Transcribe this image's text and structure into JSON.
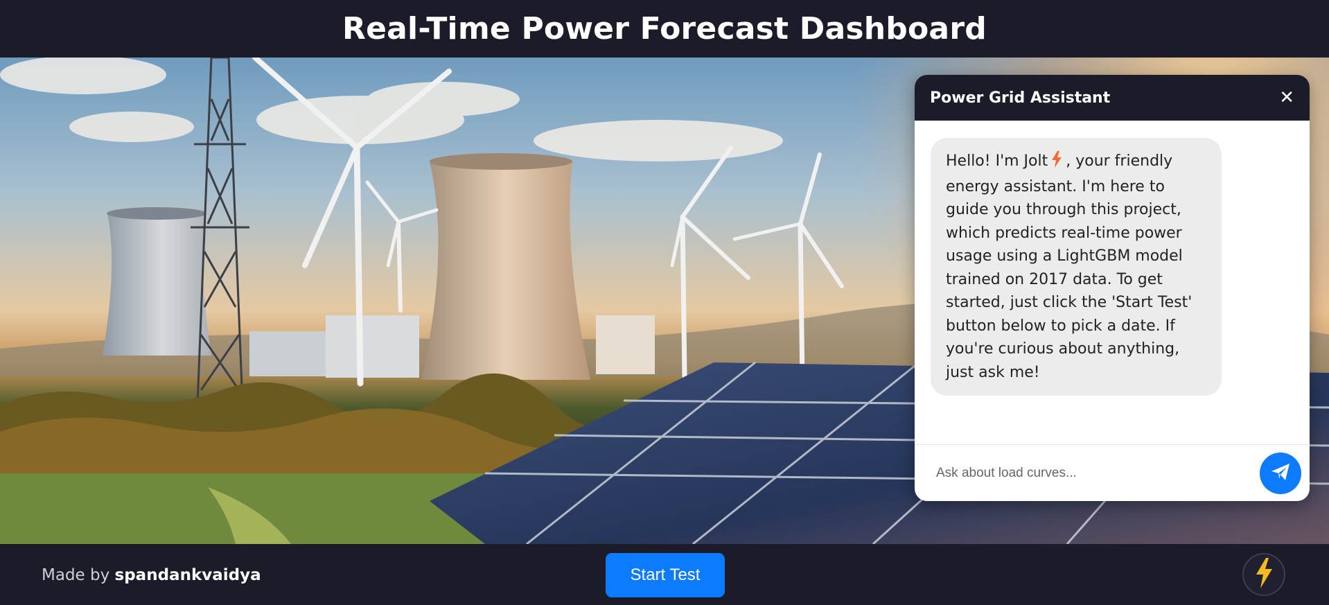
{
  "header": {
    "title": "Real-Time Power Forecast Dashboard"
  },
  "hero": {
    "image": "wind-turbines-cooling-towers-solar-panels-scene"
  },
  "chat": {
    "title": "Power Grid Assistant",
    "close_label": "✕",
    "messages": [
      {
        "sender": "assistant",
        "text_before_icon": "Hello! I'm Jolt",
        "icon": "lightning-icon",
        "text_after_icon": ", your friendly energy assistant. I'm here to guide you through this project, which predicts real-time power usage using a LightGBM model trained on 2017 data. To get started, just click the 'Start Test' button below to pick a date. If you're curious about anything, just ask me!"
      }
    ],
    "input": {
      "placeholder": "Ask about load curves...",
      "value": ""
    },
    "send_icon": "paper-plane-icon"
  },
  "footer": {
    "credit_prefix": "Made by",
    "credit_name": "spandankvaidya",
    "start_button": "Start Test",
    "assistant_toggle_icon": "lightning-icon"
  },
  "colors": {
    "background": "#1b1b2a",
    "accent": "#0d7bfd",
    "bubble": "#ececec",
    "bolt": "#f5b921"
  }
}
